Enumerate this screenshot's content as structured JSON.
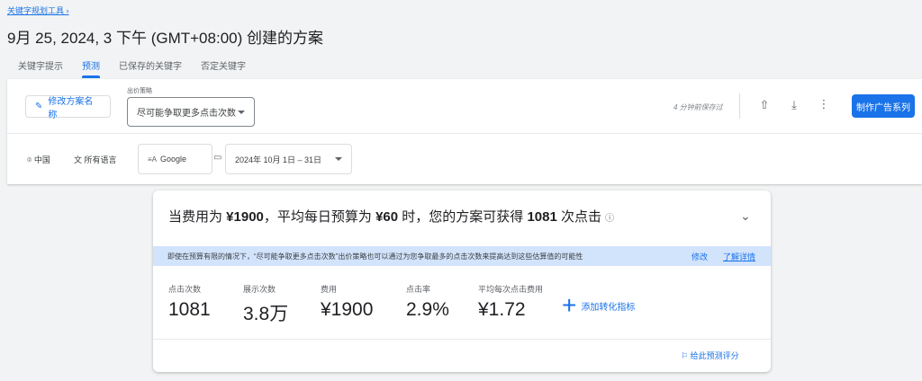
{
  "breadcrumb": "关键字规划工具",
  "title": "9月 25, 2024, 3 下午 (GMT+08:00) 创建的方案",
  "tabs": [
    {
      "label": "关键字提示"
    },
    {
      "label": "预测"
    },
    {
      "label": "已保存的关键字"
    },
    {
      "label": "否定关键字"
    }
  ],
  "toolbar": {
    "rename": "修改方案名称",
    "bid_label": "出价策略",
    "bid_value": "尽可能争取更多点击次数",
    "saved": "4 分钟前保存过",
    "create": "制作广告系列"
  },
  "filters": {
    "location": "中国",
    "language": "所有语言",
    "network": "Google",
    "date": "2024年 10月 1日 – 31日"
  },
  "summary": {
    "pre": "当费用为 ",
    "cost": "¥1900",
    "mid": "，平均每日预算为 ",
    "daily": "¥60",
    "mid2": " 时，您的方案可获得 ",
    "clicks": "1081",
    "post": " 次点击"
  },
  "banner": {
    "text": "即使在预算有限的情况下，“尽可能争取更多点击次数”出价策略也可以通过为您争取最多的点击次数来提高达到这些估算值的可能性",
    "edit": "修改",
    "learn": "了解详情"
  },
  "metrics": [
    {
      "label": "点击次数",
      "value": "1081"
    },
    {
      "label": "展示次数",
      "value": "3.8万"
    },
    {
      "label": "费用",
      "value": "¥1900"
    },
    {
      "label": "点击率",
      "value": "2.9%"
    },
    {
      "label": "平均每次点击费用",
      "value": "¥1.72"
    }
  ],
  "add_metric": "添加转化指标",
  "feedback": "给此预测评分"
}
